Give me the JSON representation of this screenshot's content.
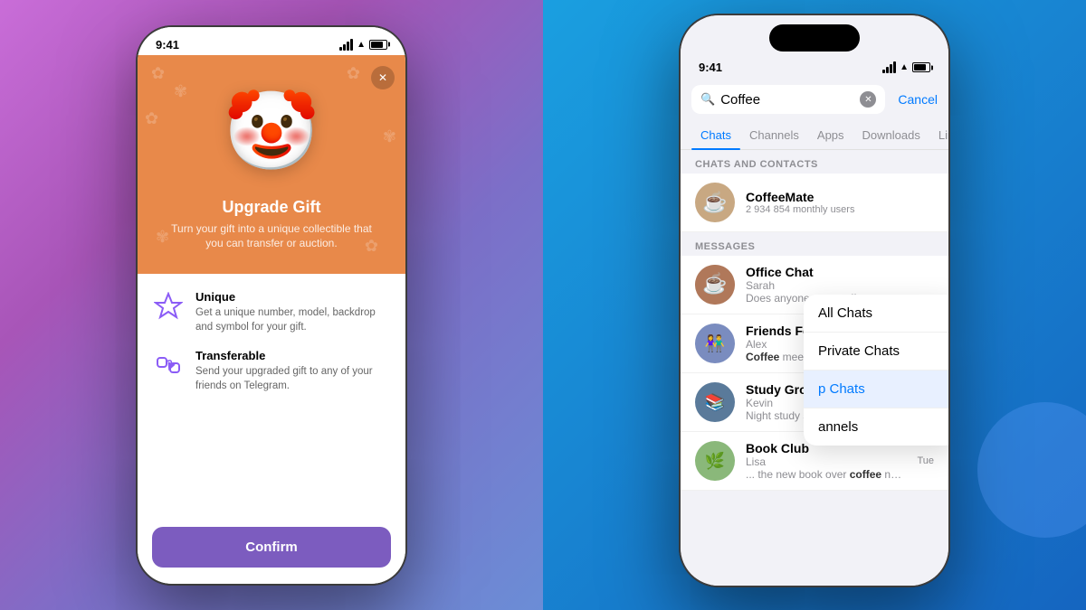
{
  "left": {
    "statusTime": "9:41",
    "modal": {
      "title": "Upgrade Gift",
      "subtitle": "Turn your gift into a unique collectible that you can transfer or auction.",
      "features": [
        {
          "icon": "💎",
          "title": "Unique",
          "description": "Get a unique number, model, backdrop and symbol for your gift."
        },
        {
          "icon": "🔄",
          "title": "Transferable",
          "description": "Send your upgraded gift to any of your friends on Telegram."
        }
      ],
      "confirmLabel": "Confirm"
    }
  },
  "right": {
    "statusTime": "9:41",
    "searchQuery": "Coffee",
    "cancelLabel": "Cancel",
    "tabs": [
      {
        "label": "Chats",
        "active": true
      },
      {
        "label": "Channels",
        "active": false
      },
      {
        "label": "Apps",
        "active": false
      },
      {
        "label": "Downloads",
        "active": false
      },
      {
        "label": "Links",
        "active": false
      }
    ],
    "chatsAndContactsHeader": "CHATS AND CONTACTS",
    "messagesHeader": "MESSAGES",
    "contacts": [
      {
        "name": "CoffeeMate",
        "sub": "2 934 854 monthly users",
        "avatar": "☕",
        "avatarBg": "#c8a882"
      }
    ],
    "messages": [
      {
        "name": "Office Chat",
        "sender": "Sarah",
        "preview": "Does anyone want coffe",
        "highlight": "",
        "time": "",
        "avatar": "☕",
        "avatarBg": "#b0785a"
      },
      {
        "name": "Friends Forever",
        "sender": "Alex",
        "preview": "Coffee meetup at 3 PM t",
        "highlight": "Coffee",
        "time": "",
        "avatar": "👫",
        "avatarBg": "#7a8cbf"
      },
      {
        "name": "Study Group",
        "sender": "Kevin",
        "preview": "Night study session calls for lots of coffee...",
        "highlight": "coffee",
        "time": "",
        "avatar": "📚",
        "avatarBg": "#6a9fbf"
      },
      {
        "name": "Book Club",
        "sender": "Lisa",
        "preview": "... the new book over coffee next weekend ...",
        "highlight": "coffee",
        "time": "Tue",
        "avatar": "🌿",
        "avatarBg": "#8ab87a"
      }
    ],
    "dropdown": {
      "items": [
        "All Chats",
        "Private Chats",
        "Group Chats",
        "Channels"
      ]
    }
  }
}
